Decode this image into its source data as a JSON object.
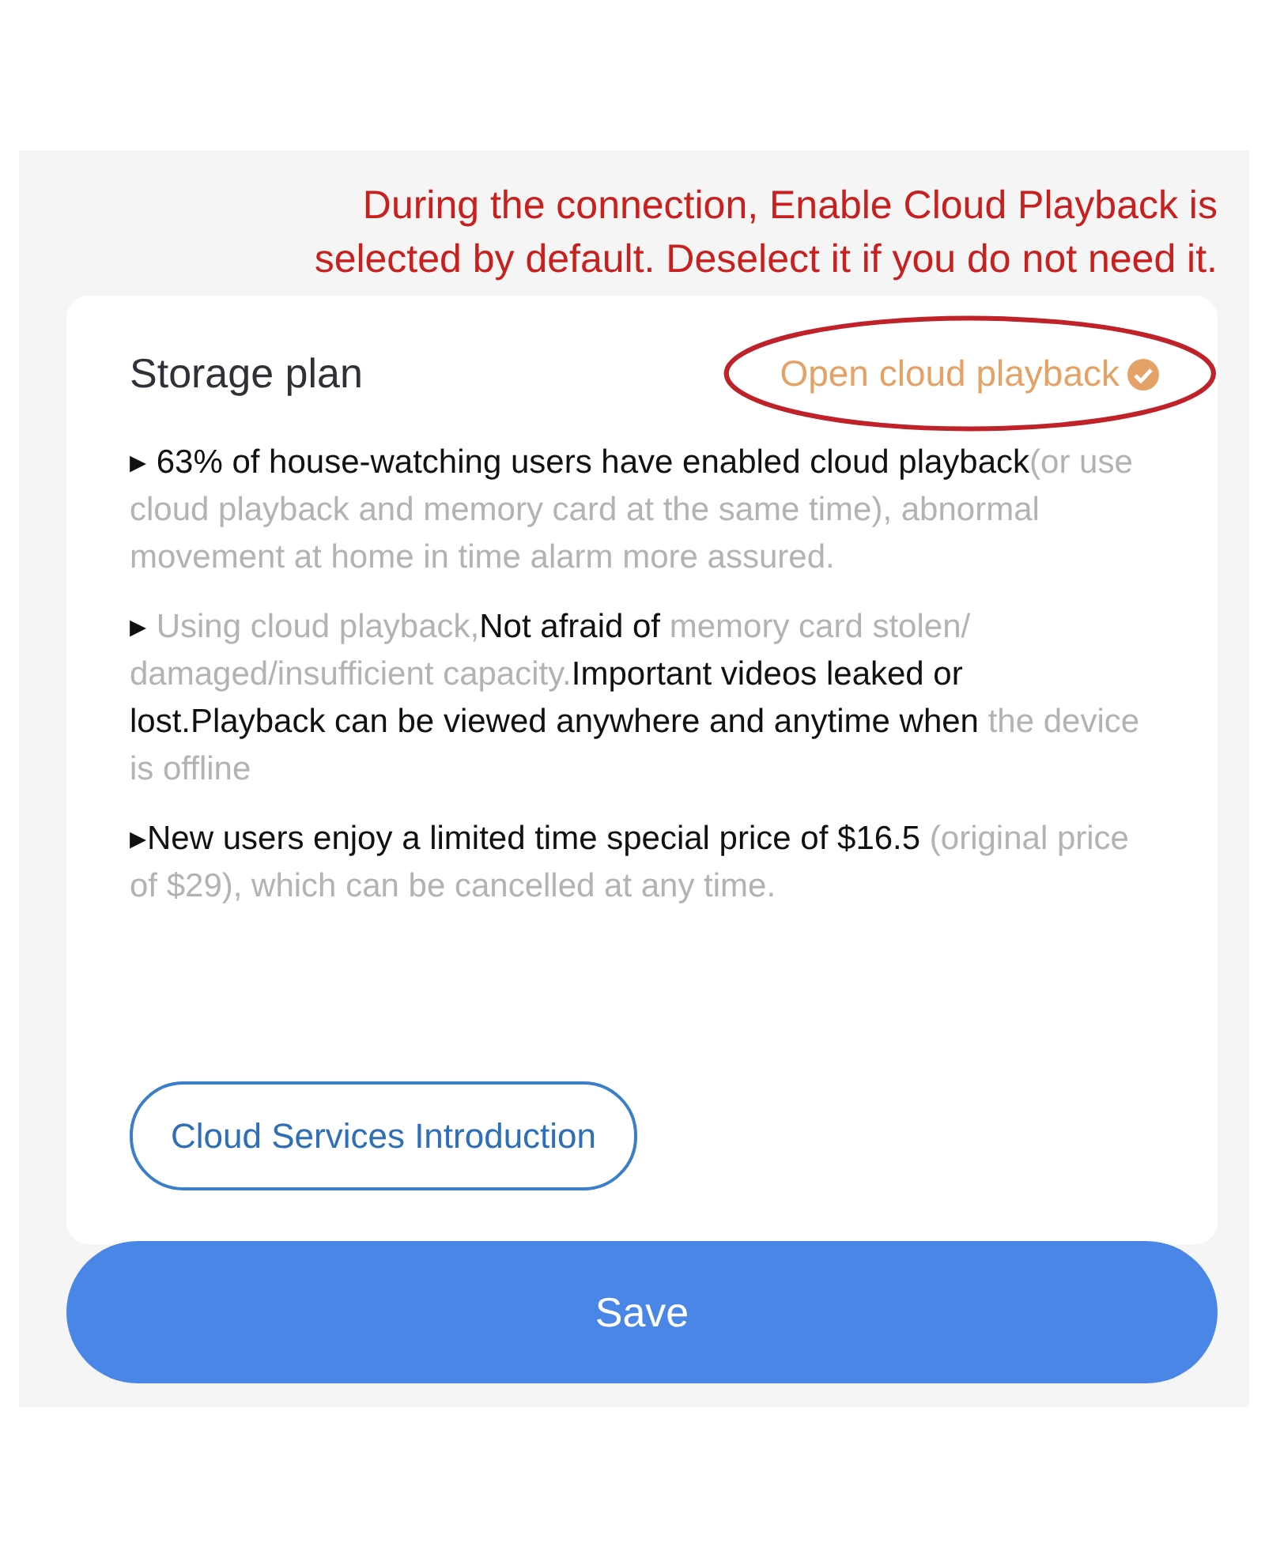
{
  "annotation": {
    "lines": [
      "During the connection, Enable Cloud Playback is",
      "selected by default. Deselect it if you do not need it."
    ]
  },
  "card": {
    "title": "Storage plan",
    "cloud_playback": {
      "label": "Open cloud playback",
      "checked": true,
      "annotated": true
    },
    "points": [
      {
        "marker": "▸",
        "segments": [
          {
            "text": " 63% of house-watching users have enabled cloud playback",
            "emphasis": true
          },
          {
            "text": "(or use cloud playback and memory card at the same time), abnormal movement at home in time alarm more assured.",
            "emphasis": false
          }
        ]
      },
      {
        "marker": "▸",
        "segments": [
          {
            "text": " Using cloud playback,",
            "emphasis": false
          },
          {
            "text": "Not afraid of ",
            "emphasis": true
          },
          {
            "text": "memory card stolen/ damaged/insufficient capacity.",
            "emphasis": false
          },
          {
            "text": "Important videos leaked or lost.Playback can be viewed anywhere and anytime when ",
            "emphasis": true
          },
          {
            "text": "the device is offline",
            "emphasis": false
          }
        ]
      },
      {
        "marker": "▸",
        "segments": [
          {
            "text": "New users enjoy a limited time special price of $16.5 ",
            "emphasis": true
          },
          {
            "text": "(original price of $29), which can be cancelled at any time.",
            "emphasis": false
          }
        ]
      }
    ],
    "intro_button": "Cloud Services Introduction"
  },
  "save_button": "Save"
}
